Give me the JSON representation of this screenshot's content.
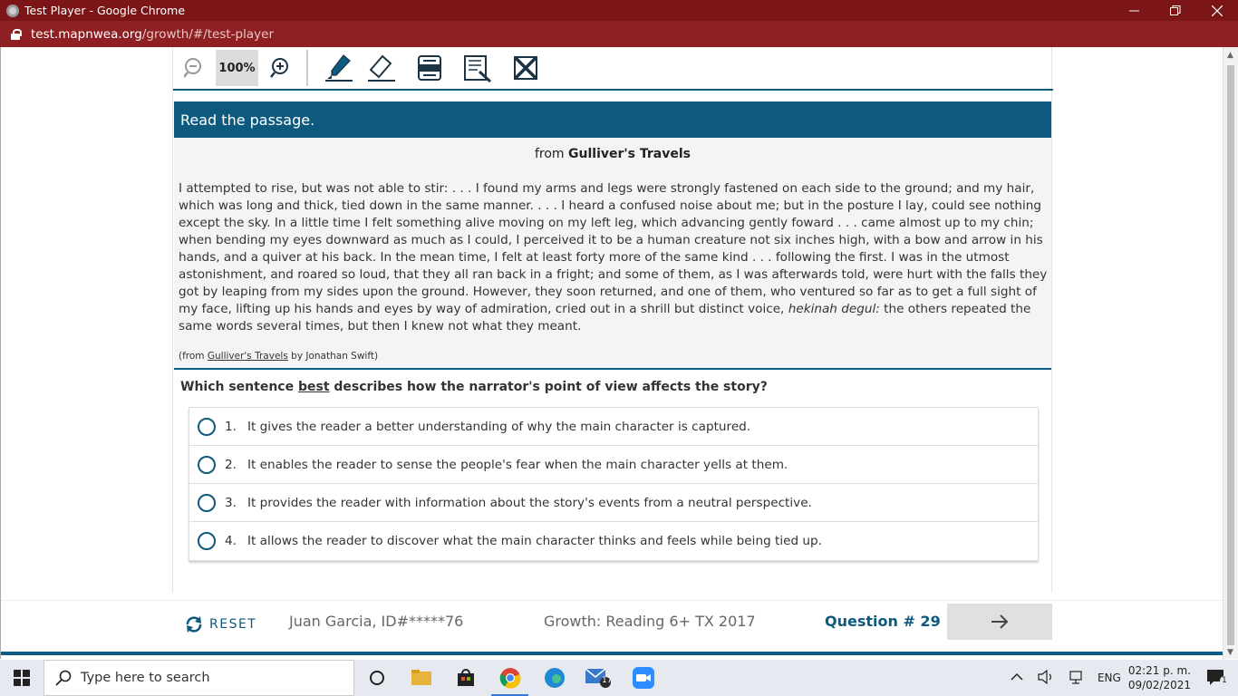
{
  "window": {
    "title": "Test Player - Google Chrome",
    "url_host": "test.mapnwea.org",
    "url_path": "/growth/#/test-player"
  },
  "toolbar": {
    "zoom_level": "100%",
    "tools": [
      "zoom-out-icon",
      "zoom-in-icon",
      "highlighter-icon",
      "eraser-icon",
      "line-reader-icon",
      "notepad-icon",
      "answer-eliminator-icon"
    ]
  },
  "passage": {
    "header": "Read the passage.",
    "title_prefix": "from",
    "title": "Gulliver's Travels",
    "body_part1": "I attempted to rise, but was not able to stir: . . . I found my arms and legs were strongly fastened on each side to the ground; and my hair, which was long and thick, tied down in the same manner. . . . I heard a confused noise about me; but in the posture I lay, could see nothing except the sky. In a little time I felt something alive moving on my left leg, which advancing gently foward . . . came almost up to my chin; when bending my eyes downward as much as I could, I perceived it to be a human creature not six inches high, with a bow and arrow in his hands, and a quiver at his back. In the mean time, I felt at least forty more of the same kind . . . following the first. I was in the utmost astonishment, and roared so loud, that they all ran back in a fright; and some of them, as I was afterwards told, were hurt with the falls they got by leaping from my sides upon the ground. However, they soon returned, and one of them, who ventured so far as to get a full sight of my face, lifting up his hands and eyes by way of admiration, cried out in a shrill but distinct voice,",
    "body_italic": "hekinah degul:",
    "body_part2": "the others repeated the same words several times, but then I knew not what they meant.",
    "cite_open": "(from",
    "cite_title": "Gulliver's Travels",
    "cite_rest": "by Jonathan Swift)"
  },
  "question": {
    "before": "Which sentence",
    "emphasis": "best",
    "after": "describes how the narrator's point of view affects the story?",
    "choices": [
      {
        "num": "1.",
        "text": "It gives the reader a better understanding of why the main character is captured."
      },
      {
        "num": "2.",
        "text": "It enables the reader to sense the people's fear when the main character yells at them."
      },
      {
        "num": "3.",
        "text": "It provides the reader with information about the story's events from a neutral perspective."
      },
      {
        "num": "4.",
        "text": "It allows the reader to discover what the main character thinks and feels while being tied up."
      }
    ]
  },
  "footer": {
    "reset_label": "RESET",
    "student": "Juan Garcia, ID#*****76",
    "test_name": "Growth: Reading 6+ TX 2017",
    "question_number": "Question # 29"
  },
  "taskbar": {
    "search_placeholder": "Type here to search",
    "mail_badge": "17",
    "language": "ENG",
    "time": "02:21 p. m.",
    "date": "09/02/2021",
    "notification_count": "1"
  }
}
